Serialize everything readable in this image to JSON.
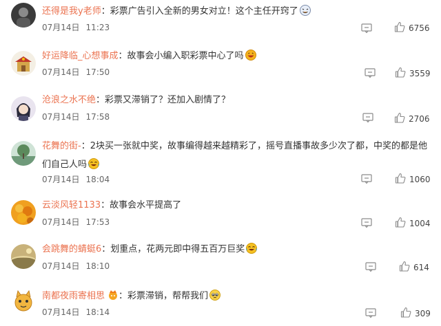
{
  "comments": [
    {
      "username": "还得是我y老师",
      "sep": "：",
      "text": "彩票广告引入全新的男女对立！这个主任开窍了",
      "emoji": "laughing-dizzy-emoji",
      "date": "07月14日",
      "time": "11:23",
      "likes": "6756"
    },
    {
      "username": "好运降临_心想事成",
      "sep": "：",
      "text": "故事会小编入职彩票中心了吗",
      "emoji": "grinning-emoji",
      "date": "07月14日",
      "time": "17:50",
      "likes": "3559"
    },
    {
      "username": "沧浪之水不绝",
      "sep": "：",
      "text": "彩票又滞销了？还加入剧情了？",
      "emoji": "",
      "date": "07月14日",
      "time": "17:58",
      "likes": "2706"
    },
    {
      "username": "花舞的街-",
      "sep": "：",
      "text": "2块买一张就中奖，故事编得越来越精彩了，摇号直播事故多少次了都，中奖的都是他们自己人吗",
      "emoji": "laugh-cry-emoji",
      "date": "07月14日",
      "time": "18:04",
      "likes": "1060"
    },
    {
      "username": "云淡风轻1133",
      "sep": "：",
      "text": "故事会水平提高了",
      "emoji": "",
      "date": "07月14日",
      "time": "17:53",
      "likes": "1004"
    },
    {
      "username": "会跳舞的蜻蜓6",
      "sep": "：",
      "text": "划重点，花两元即中得五百万巨奖",
      "emoji": "laugh-cry-emoji",
      "date": "07月14日",
      "time": "18:10",
      "likes": "614"
    },
    {
      "username": "南都夜雨寄相思",
      "sep": "：",
      "text": "彩票滞销，帮帮我们",
      "emoji": "pleading-emoji",
      "badge": "fan-badge-icon",
      "date": "07月14日",
      "time": "18:14",
      "likes": "309"
    }
  ],
  "colors": {
    "username": "#eb7350",
    "text": "#333333",
    "meta": "#666666",
    "icon": "#8a8a8a"
  }
}
